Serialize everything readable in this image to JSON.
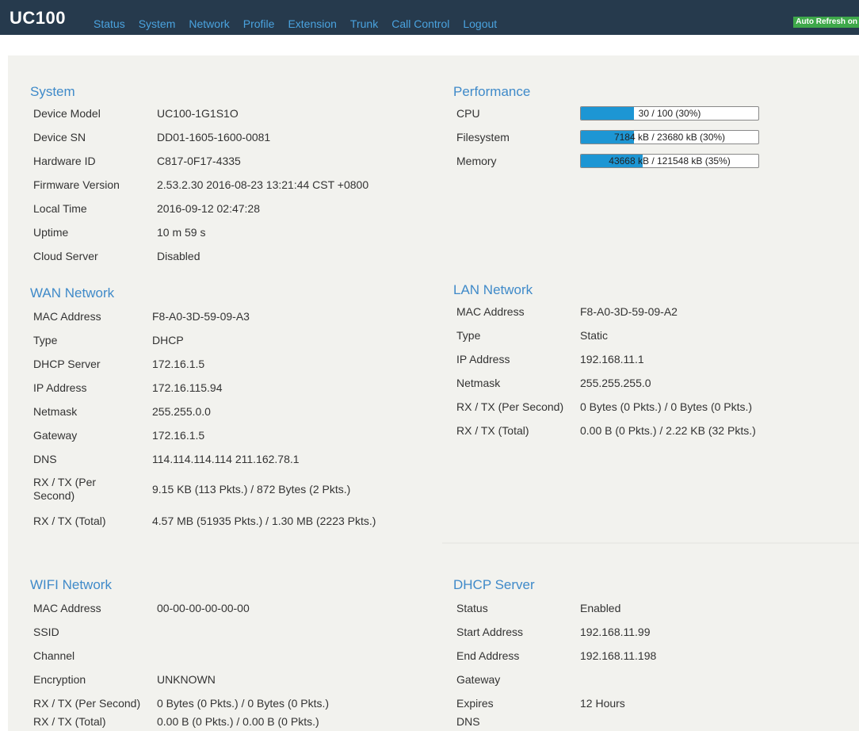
{
  "brand": "UC100",
  "nav": [
    "Status",
    "System",
    "Network",
    "Profile",
    "Extension",
    "Trunk",
    "Call Control",
    "Logout"
  ],
  "auto_refresh": "Auto Refresh on",
  "system": {
    "title": "System",
    "rows": [
      {
        "k": "Device Model",
        "v": "UC100-1G1S1O"
      },
      {
        "k": "Device SN",
        "v": "DD01-1605-1600-0081"
      },
      {
        "k": "Hardware ID",
        "v": "C817-0F17-4335"
      },
      {
        "k": "Firmware Version",
        "v": "2.53.2.30 2016-08-23 13:21:44 CST +0800"
      },
      {
        "k": "Local Time",
        "v": "2016-09-12 02:47:28"
      },
      {
        "k": "Uptime",
        "v": "10 m 59 s"
      },
      {
        "k": "Cloud Server",
        "v": "Disabled"
      }
    ]
  },
  "performance": {
    "title": "Performance",
    "rows": [
      {
        "k": "CPU",
        "text": "30 / 100 (30%)",
        "fraction": 0.3
      },
      {
        "k": "Filesystem",
        "text": "7184 kB / 23680 kB (30%)",
        "fraction": 0.3
      },
      {
        "k": "Memory",
        "text": "43668 kB / 121548 kB (35%)",
        "fraction": 0.35
      }
    ]
  },
  "wan": {
    "title": "WAN Network",
    "rows": [
      {
        "k": "MAC Address",
        "v": "F8-A0-3D-59-09-A3"
      },
      {
        "k": "Type",
        "v": "DHCP"
      },
      {
        "k": "DHCP Server",
        "v": "172.16.1.5"
      },
      {
        "k": "IP Address",
        "v": "172.16.115.94"
      },
      {
        "k": "Netmask",
        "v": "255.255.0.0"
      },
      {
        "k": "Gateway",
        "v": "172.16.1.5"
      },
      {
        "k": "DNS",
        "v": "114.114.114.114 211.162.78.1"
      },
      {
        "k": "RX / TX (Per Second)",
        "v": "9.15 KB (113 Pkts.) / 872 Bytes (2 Pkts.)"
      },
      {
        "k": "RX / TX (Total)",
        "v": "4.57 MB (51935 Pkts.) / 1.30 MB (2223 Pkts.)"
      }
    ]
  },
  "lan": {
    "title": "LAN Network",
    "rows": [
      {
        "k": "MAC Address",
        "v": "F8-A0-3D-59-09-A2"
      },
      {
        "k": "Type",
        "v": "Static"
      },
      {
        "k": "IP Address",
        "v": "192.168.11.1"
      },
      {
        "k": "Netmask",
        "v": "255.255.255.0"
      },
      {
        "k": "RX / TX (Per Second)",
        "v": "0 Bytes (0 Pkts.) / 0 Bytes (0 Pkts.)"
      },
      {
        "k": "RX / TX (Total)",
        "v": "0.00 B (0 Pkts.) / 2.22 KB (32 Pkts.)"
      }
    ]
  },
  "wifi": {
    "title": "WIFI Network",
    "rows": [
      {
        "k": "MAC Address",
        "v": "00-00-00-00-00-00"
      },
      {
        "k": "SSID",
        "v": ""
      },
      {
        "k": "Channel",
        "v": ""
      },
      {
        "k": "Encryption",
        "v": "UNKNOWN"
      },
      {
        "k": "RX / TX (Per Second)",
        "v": "0 Bytes (0 Pkts.) / 0 Bytes (0 Pkts.)"
      },
      {
        "k": "RX / TX (Total)",
        "v": "0.00 B (0 Pkts.) / 0.00 B (0 Pkts.)"
      }
    ]
  },
  "dhcp": {
    "title": "DHCP Server",
    "rows": [
      {
        "k": "Status",
        "v": "Enabled"
      },
      {
        "k": "Start Address",
        "v": "192.168.11.99"
      },
      {
        "k": "End Address",
        "v": "192.168.11.198"
      },
      {
        "k": "Gateway",
        "v": ""
      },
      {
        "k": "Expires",
        "v": "12 Hours"
      },
      {
        "k": "DNS",
        "v": ""
      }
    ]
  }
}
